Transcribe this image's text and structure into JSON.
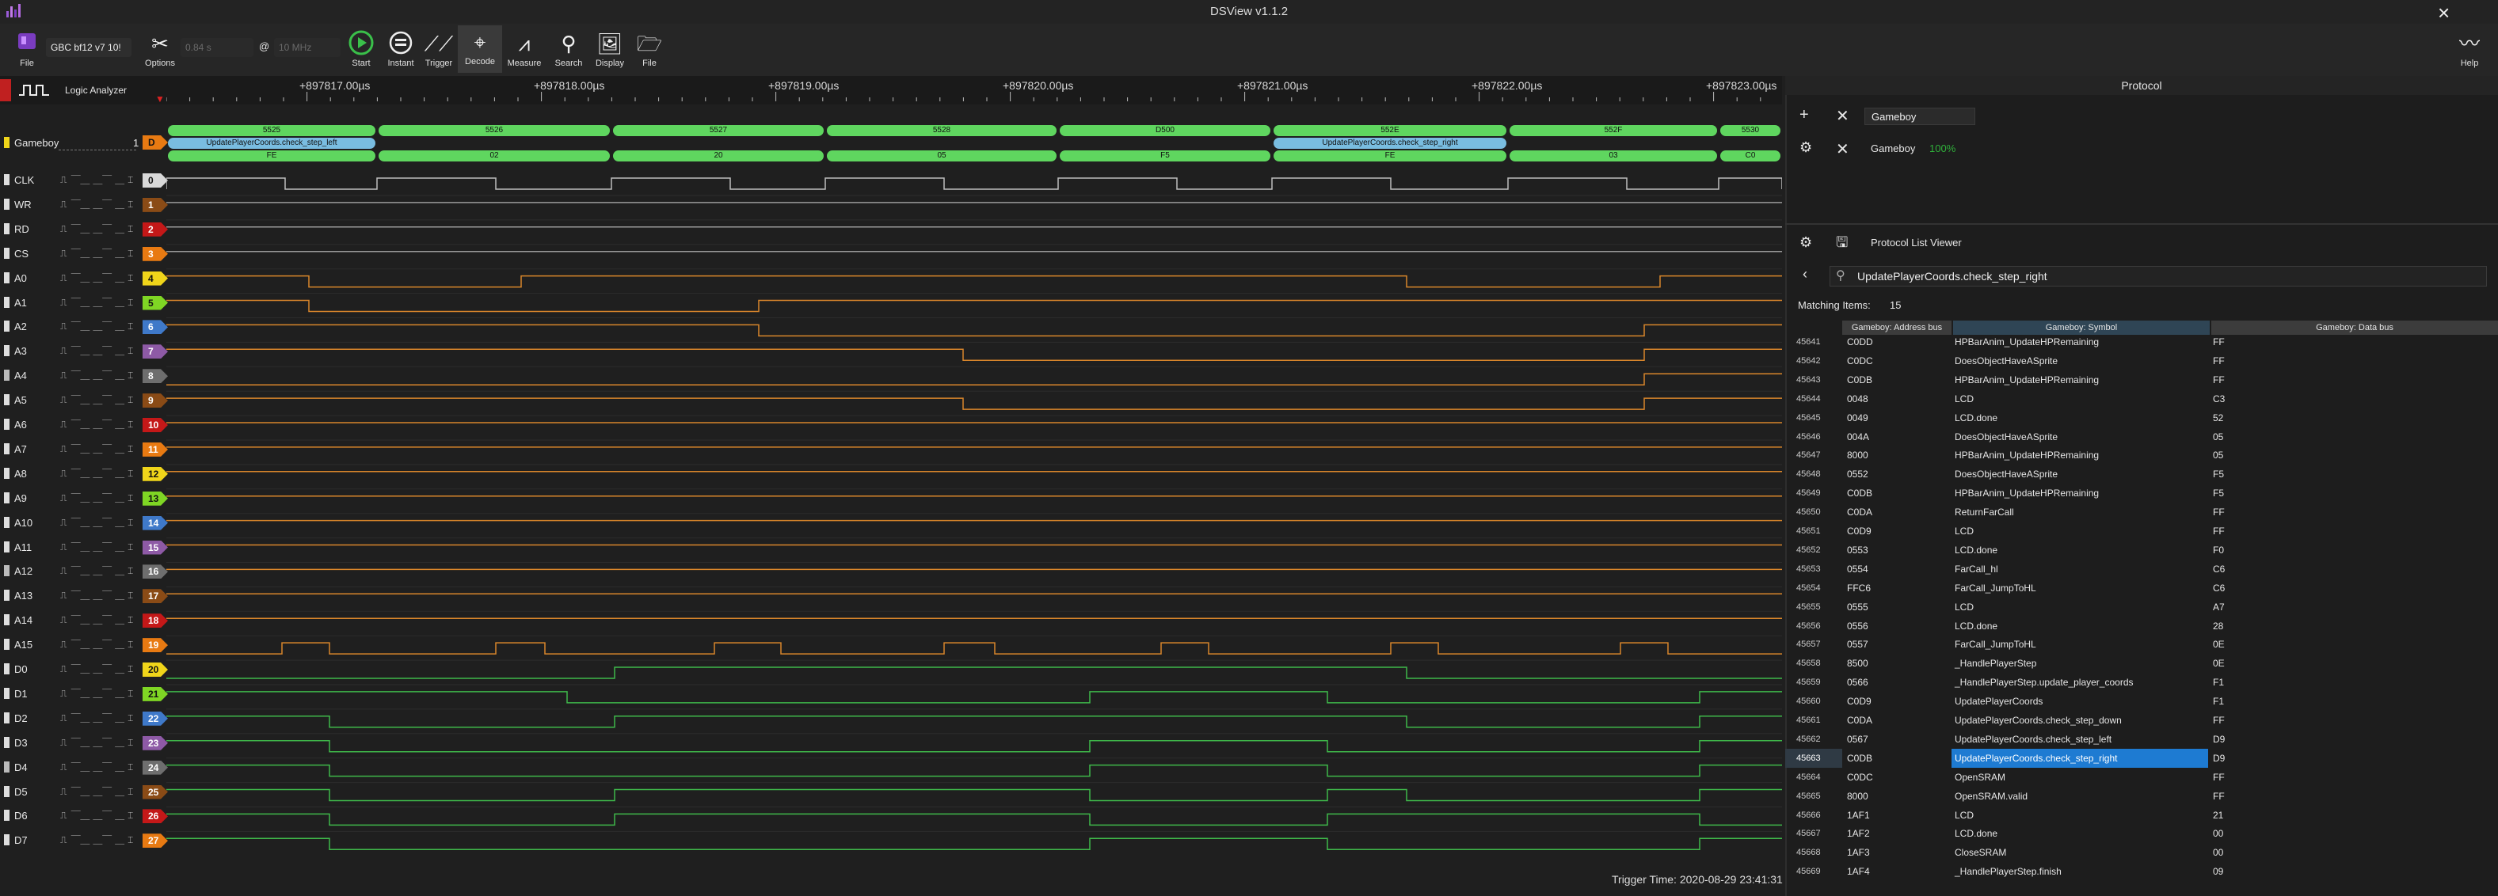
{
  "window": {
    "title": "DSView v1.1.2"
  },
  "toolbar": {
    "file_label": "File",
    "device": "GBC bf12 v7 10!",
    "sample_time": "0.84 s",
    "at": "@",
    "sample_rate": "10 MHz",
    "options": "Options",
    "start": "Start",
    "instant": "Instant",
    "trigger": "Trigger",
    "decode": "Decode",
    "measure": "Measure",
    "search": "Search",
    "display": "Display",
    "file2": "File",
    "help": "Help"
  },
  "ruler": {
    "labels": [
      "+897817.00µs",
      "+897818.00µs",
      "+897819.00µs",
      "+897820.00µs",
      "+897821.00µs",
      "+897822.00µs",
      "+897823.00µs"
    ],
    "tab": "Logic Analyzer"
  },
  "decoder": {
    "name": "Gameboy",
    "tag": "D",
    "number": "1",
    "addr_row": [
      "5525",
      "5526",
      "5527",
      "5528",
      "D500",
      "552E",
      "552F",
      "5530"
    ],
    "sym_row": [
      "UpdatePlayerCoords.check_step_left",
      "UpdatePlayerCoords.check_step_right"
    ],
    "data_row": [
      "FE",
      "02",
      "20",
      "05",
      "F5",
      "FE",
      "03",
      "C0"
    ]
  },
  "channels": [
    {
      "name": "CLK",
      "num": "0",
      "color": "#d9d9d9"
    },
    {
      "name": "WR",
      "num": "1",
      "color": "#8a4b16"
    },
    {
      "name": "RD",
      "num": "2",
      "color": "#c41818"
    },
    {
      "name": "CS",
      "num": "3",
      "color": "#e87a12"
    },
    {
      "name": "A0",
      "num": "4",
      "color": "#f0d51a"
    },
    {
      "name": "A1",
      "num": "5",
      "color": "#7fd624"
    },
    {
      "name": "A2",
      "num": "6",
      "color": "#3f79c9"
    },
    {
      "name": "A3",
      "num": "7",
      "color": "#8e5aa6"
    },
    {
      "name": "A4",
      "num": "8",
      "color": "#6e6e6e"
    },
    {
      "name": "A5",
      "num": "9",
      "color": "#8a4b16"
    },
    {
      "name": "A6",
      "num": "10",
      "color": "#c41818"
    },
    {
      "name": "A7",
      "num": "11",
      "color": "#e87a12"
    },
    {
      "name": "A8",
      "num": "12",
      "color": "#f0d51a"
    },
    {
      "name": "A9",
      "num": "13",
      "color": "#7fd624"
    },
    {
      "name": "A10",
      "num": "14",
      "color": "#3f79c9"
    },
    {
      "name": "A11",
      "num": "15",
      "color": "#8e5aa6"
    },
    {
      "name": "A12",
      "num": "16",
      "color": "#6e6e6e"
    },
    {
      "name": "A13",
      "num": "17",
      "color": "#8a4b16"
    },
    {
      "name": "A14",
      "num": "18",
      "color": "#c41818"
    },
    {
      "name": "A15",
      "num": "19",
      "color": "#e87a12"
    },
    {
      "name": "D0",
      "num": "20",
      "color": "#f0d51a"
    },
    {
      "name": "D1",
      "num": "21",
      "color": "#7fd624"
    },
    {
      "name": "D2",
      "num": "22",
      "color": "#3f79c9"
    },
    {
      "name": "D3",
      "num": "23",
      "color": "#8e5aa6"
    },
    {
      "name": "D4",
      "num": "24",
      "color": "#6e6e6e"
    },
    {
      "name": "D5",
      "num": "25",
      "color": "#8a4b16"
    },
    {
      "name": "D6",
      "num": "26",
      "color": "#c41818"
    },
    {
      "name": "D7",
      "num": "27",
      "color": "#e87a12"
    }
  ],
  "status": {
    "trigger_time": "Trigger Time: 2020-08-29 23:41:31"
  },
  "protocol": {
    "header": "Protocol",
    "decoder_select": "Gameboy",
    "decoder_name": "Gameboy",
    "progress": "100%",
    "list_viewer": "Protocol List Viewer",
    "search_value": "UpdatePlayerCoords.check_step_right",
    "matching_label": "Matching Items:",
    "matching_count": "15",
    "columns": [
      "Gameboy: Address bus",
      "Gameboy: Symbol",
      "Gameboy: Data bus"
    ],
    "rows": [
      {
        "idx": "45641",
        "addr": "C0DD",
        "sym": "HPBarAnim_UpdateHPRemaining",
        "data": "FF"
      },
      {
        "idx": "45642",
        "addr": "C0DC",
        "sym": "DoesObjectHaveASprite",
        "data": "FF"
      },
      {
        "idx": "45643",
        "addr": "C0DB",
        "sym": "HPBarAnim_UpdateHPRemaining",
        "data": "FF"
      },
      {
        "idx": "45644",
        "addr": "0048",
        "sym": "LCD",
        "data": "C3"
      },
      {
        "idx": "45645",
        "addr": "0049",
        "sym": "LCD.done",
        "data": "52"
      },
      {
        "idx": "45646",
        "addr": "004A",
        "sym": "DoesObjectHaveASprite",
        "data": "05"
      },
      {
        "idx": "45647",
        "addr": "8000",
        "sym": "HPBarAnim_UpdateHPRemaining",
        "data": "05"
      },
      {
        "idx": "45648",
        "addr": "0552",
        "sym": "DoesObjectHaveASprite",
        "data": "F5"
      },
      {
        "idx": "45649",
        "addr": "C0DB",
        "sym": "HPBarAnim_UpdateHPRemaining",
        "data": "F5"
      },
      {
        "idx": "45650",
        "addr": "C0DA",
        "sym": "ReturnFarCall",
        "data": "FF"
      },
      {
        "idx": "45651",
        "addr": "C0D9",
        "sym": "LCD",
        "data": "FF"
      },
      {
        "idx": "45652",
        "addr": "0553",
        "sym": "LCD.done",
        "data": "F0"
      },
      {
        "idx": "45653",
        "addr": "0554",
        "sym": "FarCall_hl",
        "data": "C6"
      },
      {
        "idx": "45654",
        "addr": "FFC6",
        "sym": "FarCall_JumpToHL",
        "data": "C6"
      },
      {
        "idx": "45655",
        "addr": "0555",
        "sym": "LCD",
        "data": "A7"
      },
      {
        "idx": "45656",
        "addr": "0556",
        "sym": "LCD.done",
        "data": "28"
      },
      {
        "idx": "45657",
        "addr": "0557",
        "sym": "FarCall_JumpToHL",
        "data": "0E"
      },
      {
        "idx": "45658",
        "addr": "8500",
        "sym": "_HandlePlayerStep",
        "data": "0E"
      },
      {
        "idx": "45659",
        "addr": "0566",
        "sym": "_HandlePlayerStep.update_player_coords",
        "data": "F1"
      },
      {
        "idx": "45660",
        "addr": "C0D9",
        "sym": "UpdatePlayerCoords",
        "data": "F1"
      },
      {
        "idx": "45661",
        "addr": "C0DA",
        "sym": "UpdatePlayerCoords.check_step_down",
        "data": "FF"
      },
      {
        "idx": "45662",
        "addr": "0567",
        "sym": "UpdatePlayerCoords.check_step_left",
        "data": "D9"
      },
      {
        "idx": "45663",
        "addr": "C0DB",
        "sym": "UpdatePlayerCoords.check_step_right",
        "data": "D9",
        "selected": true
      },
      {
        "idx": "45664",
        "addr": "C0DC",
        "sym": "OpenSRAM",
        "data": "FF"
      },
      {
        "idx": "45665",
        "addr": "8000",
        "sym": "OpenSRAM.valid",
        "data": "FF"
      },
      {
        "idx": "45666",
        "addr": "1AF1",
        "sym": "LCD",
        "data": "21"
      },
      {
        "idx": "45667",
        "addr": "1AF2",
        "sym": "LCD.done",
        "data": "00"
      },
      {
        "idx": "45668",
        "addr": "1AF3",
        "sym": "CloseSRAM",
        "data": "00"
      },
      {
        "idx": "45669",
        "addr": "1AF4",
        "sym": "_HandlePlayerStep.finish",
        "data": "09"
      }
    ]
  }
}
